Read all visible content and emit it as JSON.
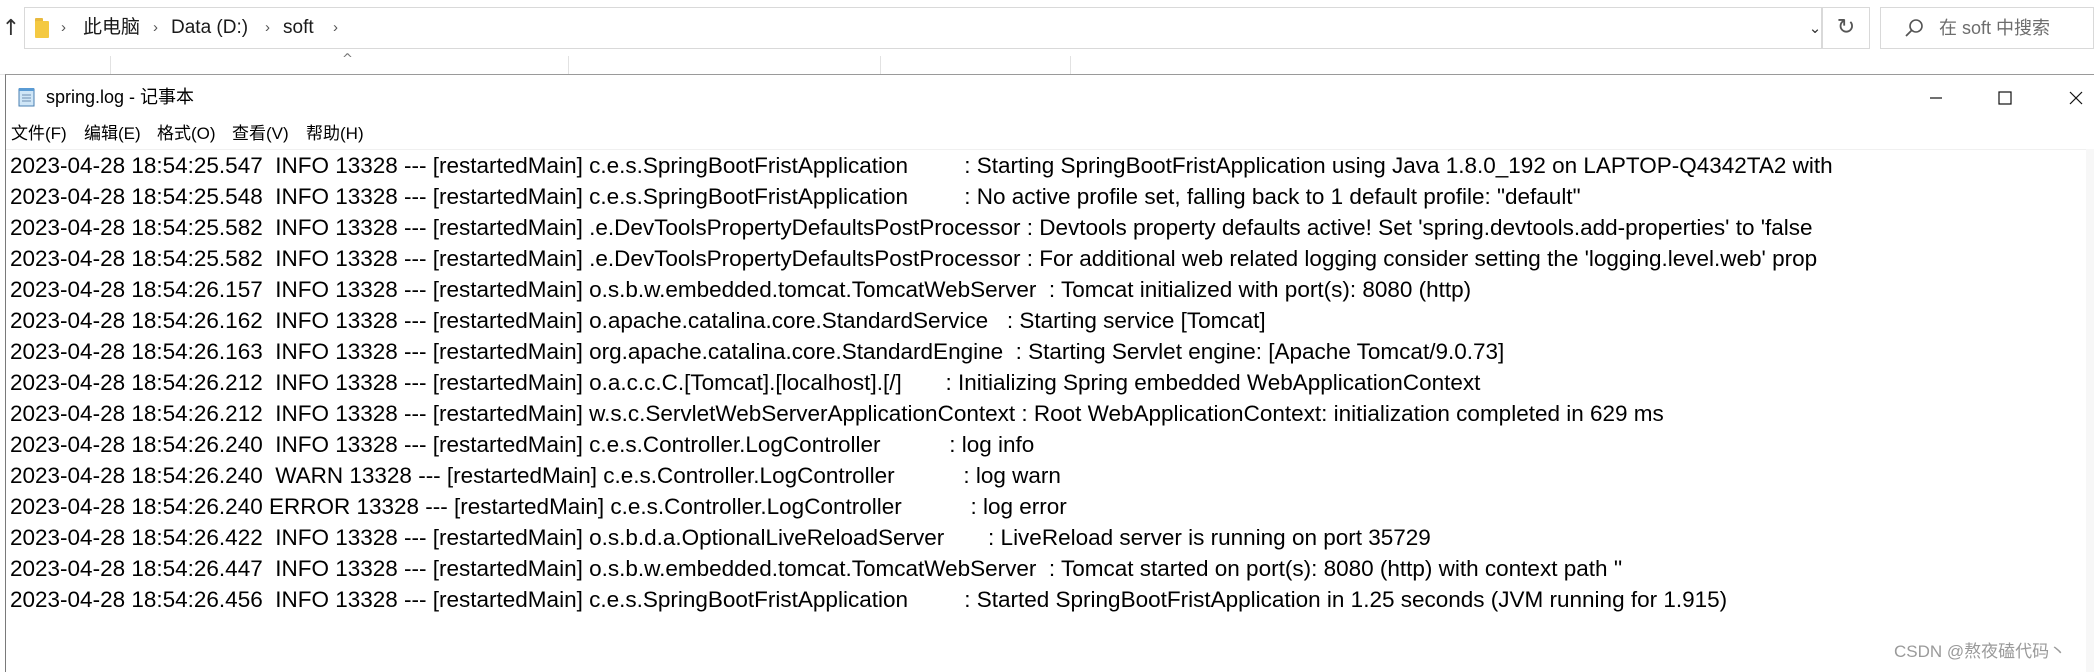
{
  "explorer": {
    "breadcrumbs": [
      "此电脑",
      "Data (D:)",
      "soft"
    ],
    "search_placeholder": "在 soft 中搜索"
  },
  "notepad": {
    "title": "spring.log - 记事本",
    "menu": [
      "文件(F)",
      "编辑(E)",
      "格式(O)",
      "查看(V)",
      "帮助(H)"
    ],
    "log_lines": [
      "2023-04-28 18:54:25.547  INFO 13328 --- [restartedMain] c.e.s.SpringBootFristApplication         : Starting SpringBootFristApplication using Java 1.8.0_192 on LAPTOP-Q4342TA2 with",
      "2023-04-28 18:54:25.548  INFO 13328 --- [restartedMain] c.e.s.SpringBootFristApplication         : No active profile set, falling back to 1 default profile: \"default\"",
      "2023-04-28 18:54:25.582  INFO 13328 --- [restartedMain] .e.DevToolsPropertyDefaultsPostProcessor : Devtools property defaults active! Set 'spring.devtools.add-properties' to 'false",
      "2023-04-28 18:54:25.582  INFO 13328 --- [restartedMain] .e.DevToolsPropertyDefaultsPostProcessor : For additional web related logging consider setting the 'logging.level.web' prop",
      "2023-04-28 18:54:26.157  INFO 13328 --- [restartedMain] o.s.b.w.embedded.tomcat.TomcatWebServer  : Tomcat initialized with port(s): 8080 (http)",
      "2023-04-28 18:54:26.162  INFO 13328 --- [restartedMain] o.apache.catalina.core.StandardService   : Starting service [Tomcat]",
      "2023-04-28 18:54:26.163  INFO 13328 --- [restartedMain] org.apache.catalina.core.StandardEngine  : Starting Servlet engine: [Apache Tomcat/9.0.73]",
      "2023-04-28 18:54:26.212  INFO 13328 --- [restartedMain] o.a.c.c.C.[Tomcat].[localhost].[/]       : Initializing Spring embedded WebApplicationContext",
      "2023-04-28 18:54:26.212  INFO 13328 --- [restartedMain] w.s.c.ServletWebServerApplicationContext : Root WebApplicationContext: initialization completed in 629 ms",
      "2023-04-28 18:54:26.240  INFO 13328 --- [restartedMain] c.e.s.Controller.LogController           : log info",
      "2023-04-28 18:54:26.240  WARN 13328 --- [restartedMain] c.e.s.Controller.LogController           : log warn",
      "2023-04-28 18:54:26.240 ERROR 13328 --- [restartedMain] c.e.s.Controller.LogController           : log error",
      "2023-04-28 18:54:26.422  INFO 13328 --- [restartedMain] o.s.b.d.a.OptionalLiveReloadServer       : LiveReload server is running on port 35729",
      "2023-04-28 18:54:26.447  INFO 13328 --- [restartedMain] o.s.b.w.embedded.tomcat.TomcatWebServer  : Tomcat started on port(s): 8080 (http) with context path ''",
      "2023-04-28 18:54:26.456  INFO 13328 --- [restartedMain] c.e.s.SpringBootFristApplication         : Started SpringBootFristApplication in 1.25 seconds (JVM running for 1.915)"
    ]
  },
  "watermark": "CSDN @熬夜磕代码丶"
}
